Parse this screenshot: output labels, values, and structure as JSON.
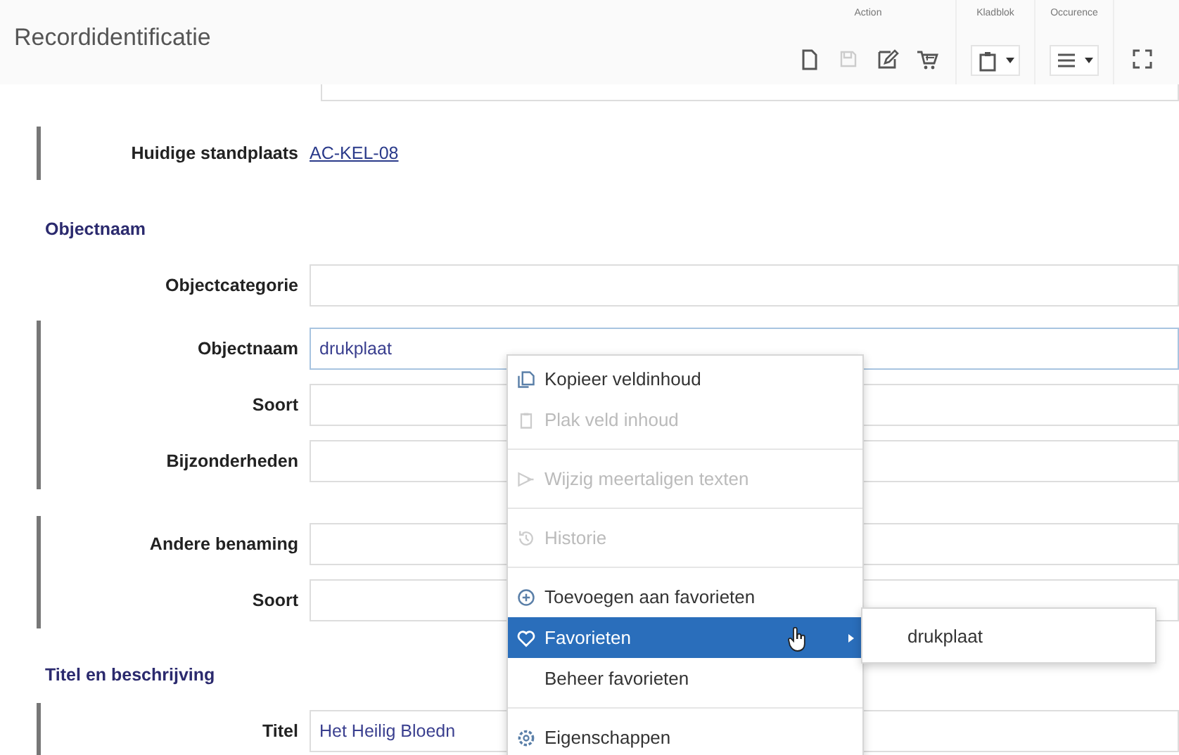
{
  "header": {
    "title": "Recordidentificatie",
    "toolbar": [
      {
        "label": "Action",
        "tools": [
          {
            "kind": "document",
            "disabled": false,
            "dropdown": false
          },
          {
            "kind": "save",
            "disabled": true,
            "dropdown": false
          },
          {
            "kind": "edit",
            "disabled": false,
            "dropdown": false
          },
          {
            "kind": "cart",
            "disabled": false,
            "dropdown": false
          }
        ]
      },
      {
        "label": "Kladblok",
        "tools": [
          {
            "kind": "clipboard",
            "disabled": false,
            "dropdown": true
          }
        ]
      },
      {
        "label": "Occurence",
        "tools": [
          {
            "kind": "list",
            "disabled": false,
            "dropdown": true
          }
        ]
      },
      {
        "tools": [
          {
            "kind": "fullscreen",
            "disabled": false,
            "dropdown": false
          }
        ]
      }
    ]
  },
  "form": [
    {
      "kind": "stub"
    },
    {
      "kind": "group",
      "bar": true,
      "rows": [
        {
          "kind": "link",
          "label": "Huidige standplaats",
          "value": "AC-KEL-08"
        }
      ]
    },
    {
      "kind": "heading",
      "text": "Objectnaam"
    },
    {
      "kind": "group",
      "bar": false,
      "rows": [
        {
          "kind": "field",
          "label": "Objectcategorie",
          "focused": false
        }
      ]
    },
    {
      "kind": "group",
      "bar": true,
      "rows": [
        {
          "kind": "field",
          "label": "Objectnaam",
          "value": "drukplaat",
          "focused": true
        },
        {
          "kind": "field",
          "label": "Soort",
          "focused": false
        },
        {
          "kind": "field",
          "label": "Bijzonderheden",
          "focused": false
        }
      ]
    },
    {
      "kind": "group",
      "bar": true,
      "rows": [
        {
          "kind": "field",
          "label": "Andere benaming",
          "focused": false
        },
        {
          "kind": "field",
          "label": "Soort",
          "focused": false
        }
      ]
    },
    {
      "kind": "heading",
      "text": "Titel en beschrijving"
    },
    {
      "kind": "group",
      "bar": true,
      "rows": [
        {
          "kind": "field",
          "label": "Titel",
          "value": "Het Heilig Bloedn",
          "focused": false
        }
      ]
    }
  ],
  "context_menu": {
    "items": [
      {
        "kind": "copy",
        "label": "Kopieer veldinhoud",
        "disabled": false,
        "selected": false,
        "submenu": false
      },
      {
        "kind": "paste",
        "label": "Plak veld inhoud",
        "disabled": true,
        "selected": false,
        "submenu": false
      },
      {
        "kind": "separator"
      },
      {
        "kind": "translate",
        "label": "Wijzig meertaligen texten",
        "disabled": true,
        "selected": false,
        "submenu": false
      },
      {
        "kind": "separator"
      },
      {
        "kind": "history",
        "label": "Historie",
        "disabled": true,
        "selected": false,
        "submenu": false
      },
      {
        "kind": "separator"
      },
      {
        "kind": "add",
        "label": "Toevoegen aan favorieten",
        "disabled": false,
        "selected": false,
        "submenu": false
      },
      {
        "kind": "heart",
        "label": "Favorieten",
        "disabled": false,
        "selected": true,
        "submenu": true
      },
      {
        "kind": "plain",
        "label": "Beheer favorieten",
        "disabled": false,
        "selected": false,
        "submenu": false
      },
      {
        "kind": "separator"
      },
      {
        "kind": "gear",
        "label": "Eigenschappen",
        "disabled": false,
        "selected": false,
        "submenu": false
      }
    ],
    "submenu": {
      "items": [
        {
          "label": "drukplaat"
        }
      ]
    }
  }
}
